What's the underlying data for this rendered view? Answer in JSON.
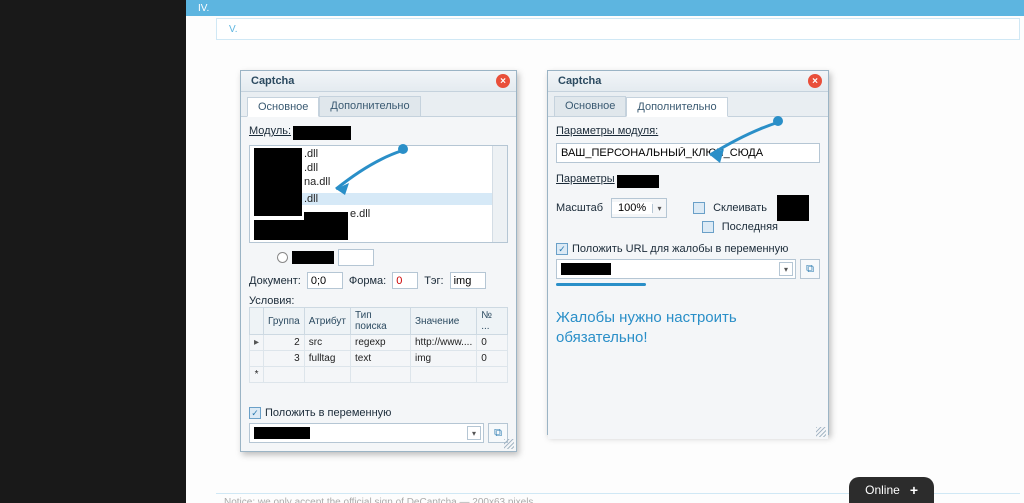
{
  "bars": {
    "row1": "IV.",
    "row2": "V."
  },
  "dialog1": {
    "title": "Captcha",
    "tabs": {
      "main": "Основное",
      "extra": "Дополнительно"
    },
    "module_label": "Модуль:",
    "list": {
      "i1": ".dll",
      "i2": ".dll",
      "i3": "na.dll",
      "i4": ".dll",
      "i5": "e.dll"
    },
    "doc_label": "Документ:",
    "doc_val": "0;0",
    "form_label": "Форма:",
    "form_val": "0",
    "tag_label": "Тэг:",
    "tag_val": "img",
    "cond_label": "Условия:",
    "cols": {
      "group": "Группа",
      "attr": "Атрибут",
      "find": "Тип поиска",
      "val": "Значение",
      "num": "№ ..."
    },
    "rows": [
      {
        "g": "2",
        "a": "src",
        "f": "regexp",
        "v": "http://www....",
        "n": "0"
      },
      {
        "g": "3",
        "a": "fulltag",
        "f": "text",
        "v": "img",
        "n": "0"
      }
    ],
    "put_var": "Положить в переменную"
  },
  "dialog2": {
    "title": "Captcha",
    "tabs": {
      "main": "Основное",
      "extra": "Дополнительно"
    },
    "mod_params": "Параметры модуля:",
    "mod_val": "ВАШ_ПЕРСОНАЛЬНЫЙ_КЛЮЧ_СЮДА",
    "params": "Параметры",
    "scale": "Масштаб",
    "scale_val": "100%",
    "glue": "Склеивать",
    "last": "Последняя",
    "put_url": "Положить URL для жалобы в переменную",
    "annotation": "Жалобы нужно настроить обязательно!"
  },
  "online": "Online",
  "notice": "Notice: we only accept the official sign of DeCaptcha — 200x63 pixels"
}
